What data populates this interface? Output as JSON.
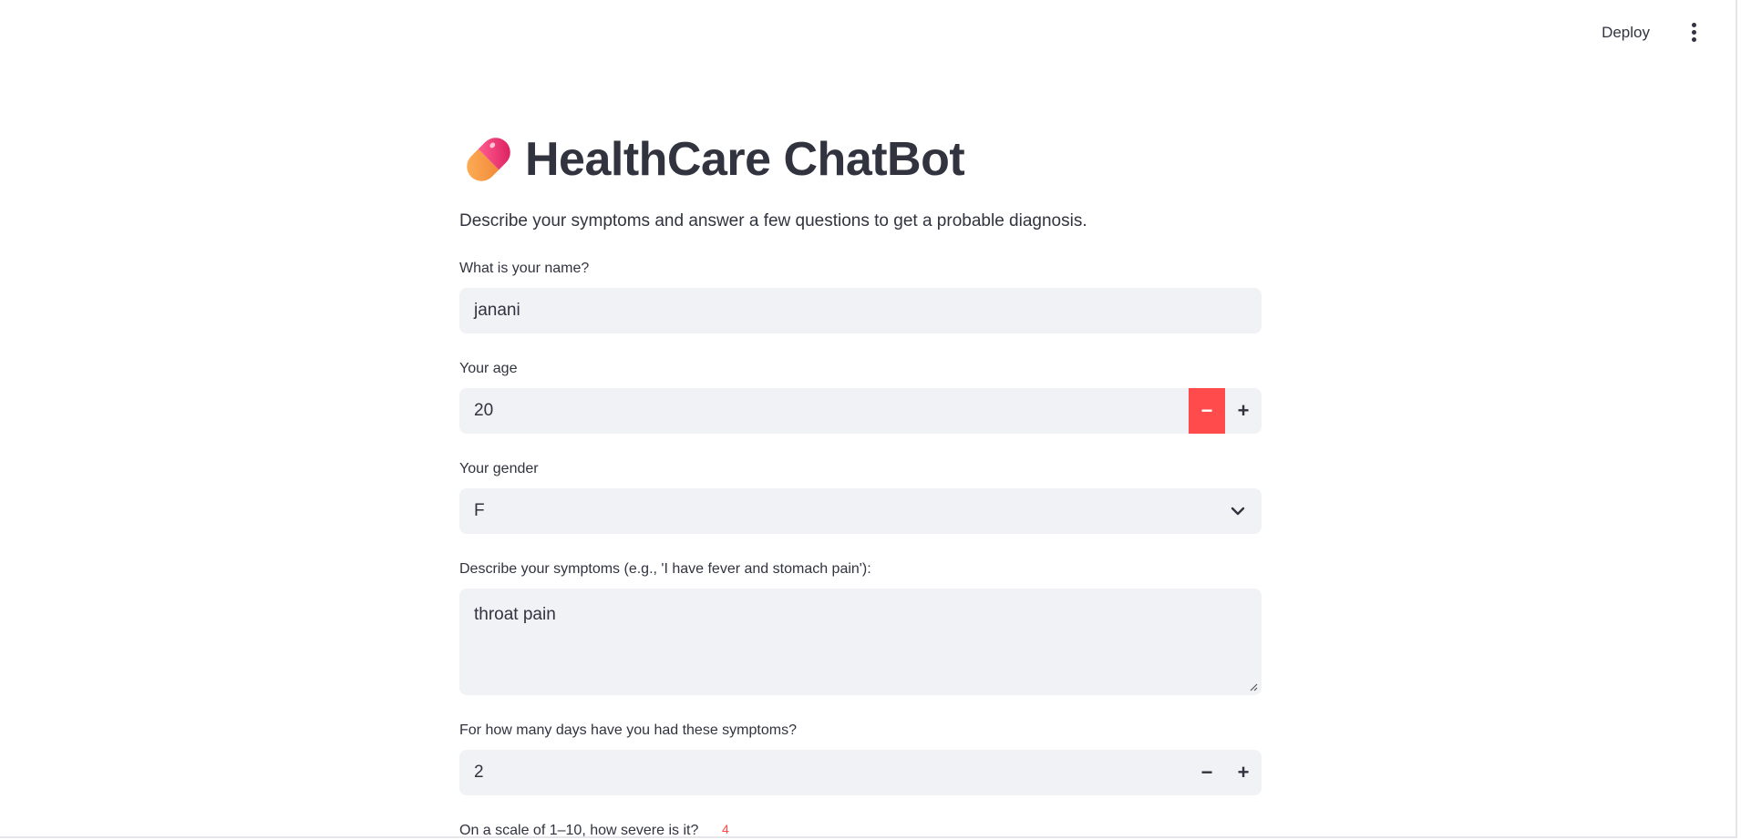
{
  "header": {
    "deploy_label": "Deploy",
    "menu_icon": "kebab-menu-icon"
  },
  "app": {
    "icon": "pill-icon",
    "title": "HealthCare ChatBot",
    "subtitle": "Describe your symptoms and answer a few questions to get a probable diagnosis."
  },
  "form": {
    "name": {
      "label": "What is your name?",
      "value": "janani"
    },
    "age": {
      "label": "Your age",
      "value": "20",
      "decrement_label": "−",
      "increment_label": "+"
    },
    "gender": {
      "label": "Your gender",
      "value": "F",
      "icon": "chevron-down-icon"
    },
    "symptoms": {
      "label": "Describe your symptoms (e.g., 'I have fever and stomach pain'):",
      "value": "throat pain"
    },
    "days": {
      "label": "For how many days have you had these symptoms?",
      "value": "2",
      "decrement_label": "−",
      "increment_label": "+"
    },
    "severity": {
      "label": "On a scale of 1–10, how severe is it?",
      "value": "4"
    }
  },
  "colors": {
    "accent": "#ff4b4b",
    "input_bg": "#f0f2f6",
    "text": "#31333f"
  }
}
